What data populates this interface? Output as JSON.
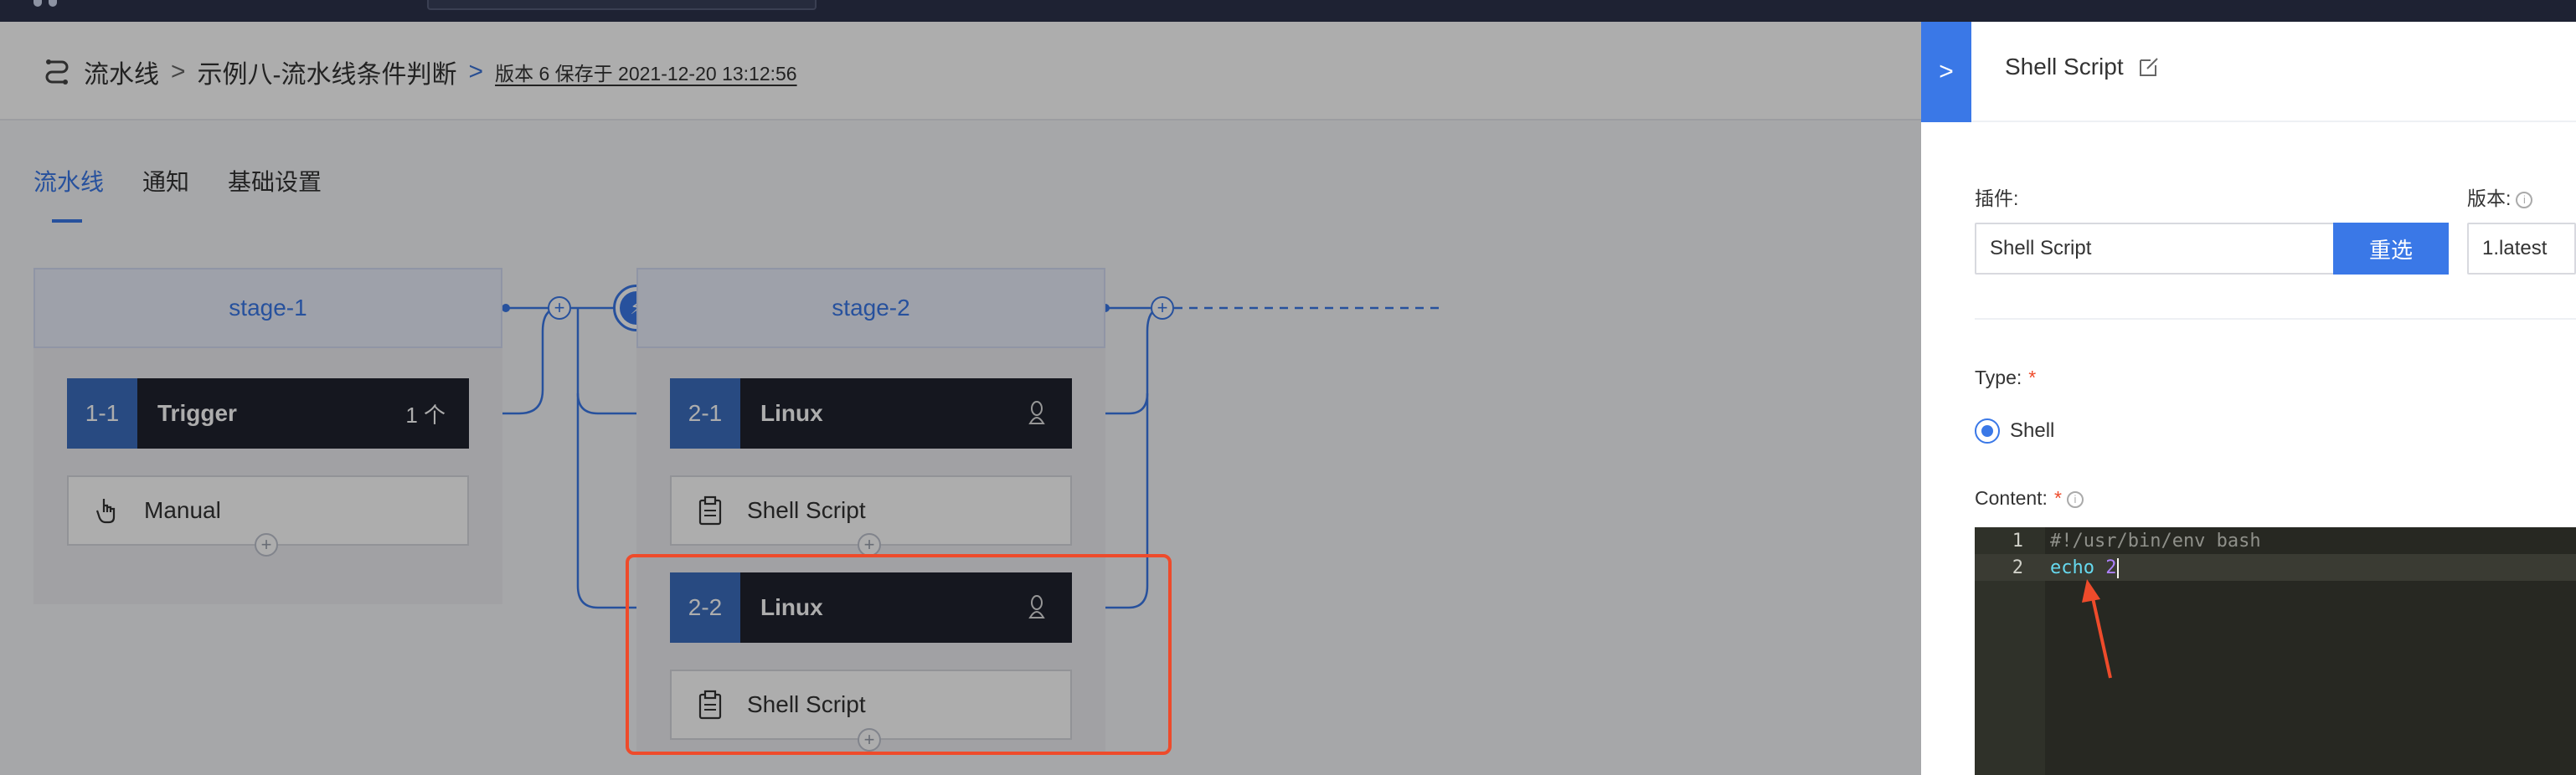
{
  "breadcrumb": {
    "root": "流水线",
    "pipeline": "示例八-流水线条件判断",
    "version": "版本 6 保存于 2021-12-20 13:12:56",
    "separator": ">"
  },
  "tabs": [
    {
      "label": "流水线",
      "active": true
    },
    {
      "label": "通知",
      "active": false
    },
    {
      "label": "基础设置",
      "active": false
    }
  ],
  "stages": [
    {
      "name": "stage-1",
      "jobs": [
        {
          "index": "1-1",
          "name": "Trigger",
          "badge": "1 个"
        }
      ],
      "tasks": [
        {
          "label": "Manual",
          "icon": "hand-pointer-icon"
        }
      ]
    },
    {
      "name": "stage-2",
      "jobs": [
        {
          "index": "2-1",
          "name": "Linux",
          "os": "linux-icon",
          "task": "Shell Script"
        },
        {
          "index": "2-2",
          "name": "Linux",
          "os": "linux-icon",
          "task": "Shell Script"
        }
      ]
    }
  ],
  "panel": {
    "collapse_glyph": ">",
    "title": "Shell Script",
    "plugin_label": "插件:",
    "plugin_value": "Shell Script",
    "reselect_label": "重选",
    "version_label": "版本:",
    "version_value": "1.latest",
    "type_label": "Type:",
    "type_option": "Shell",
    "content_label": "Content:",
    "required_mark": "*",
    "code_lines": [
      {
        "num": "1",
        "text": "#!/usr/bin/env bash"
      },
      {
        "num": "2",
        "keyword": "echo",
        "arg": "2"
      }
    ]
  },
  "colors": {
    "accent": "#3a78e7",
    "highlight": "#ee4b2b",
    "nav": "#1e2233"
  }
}
